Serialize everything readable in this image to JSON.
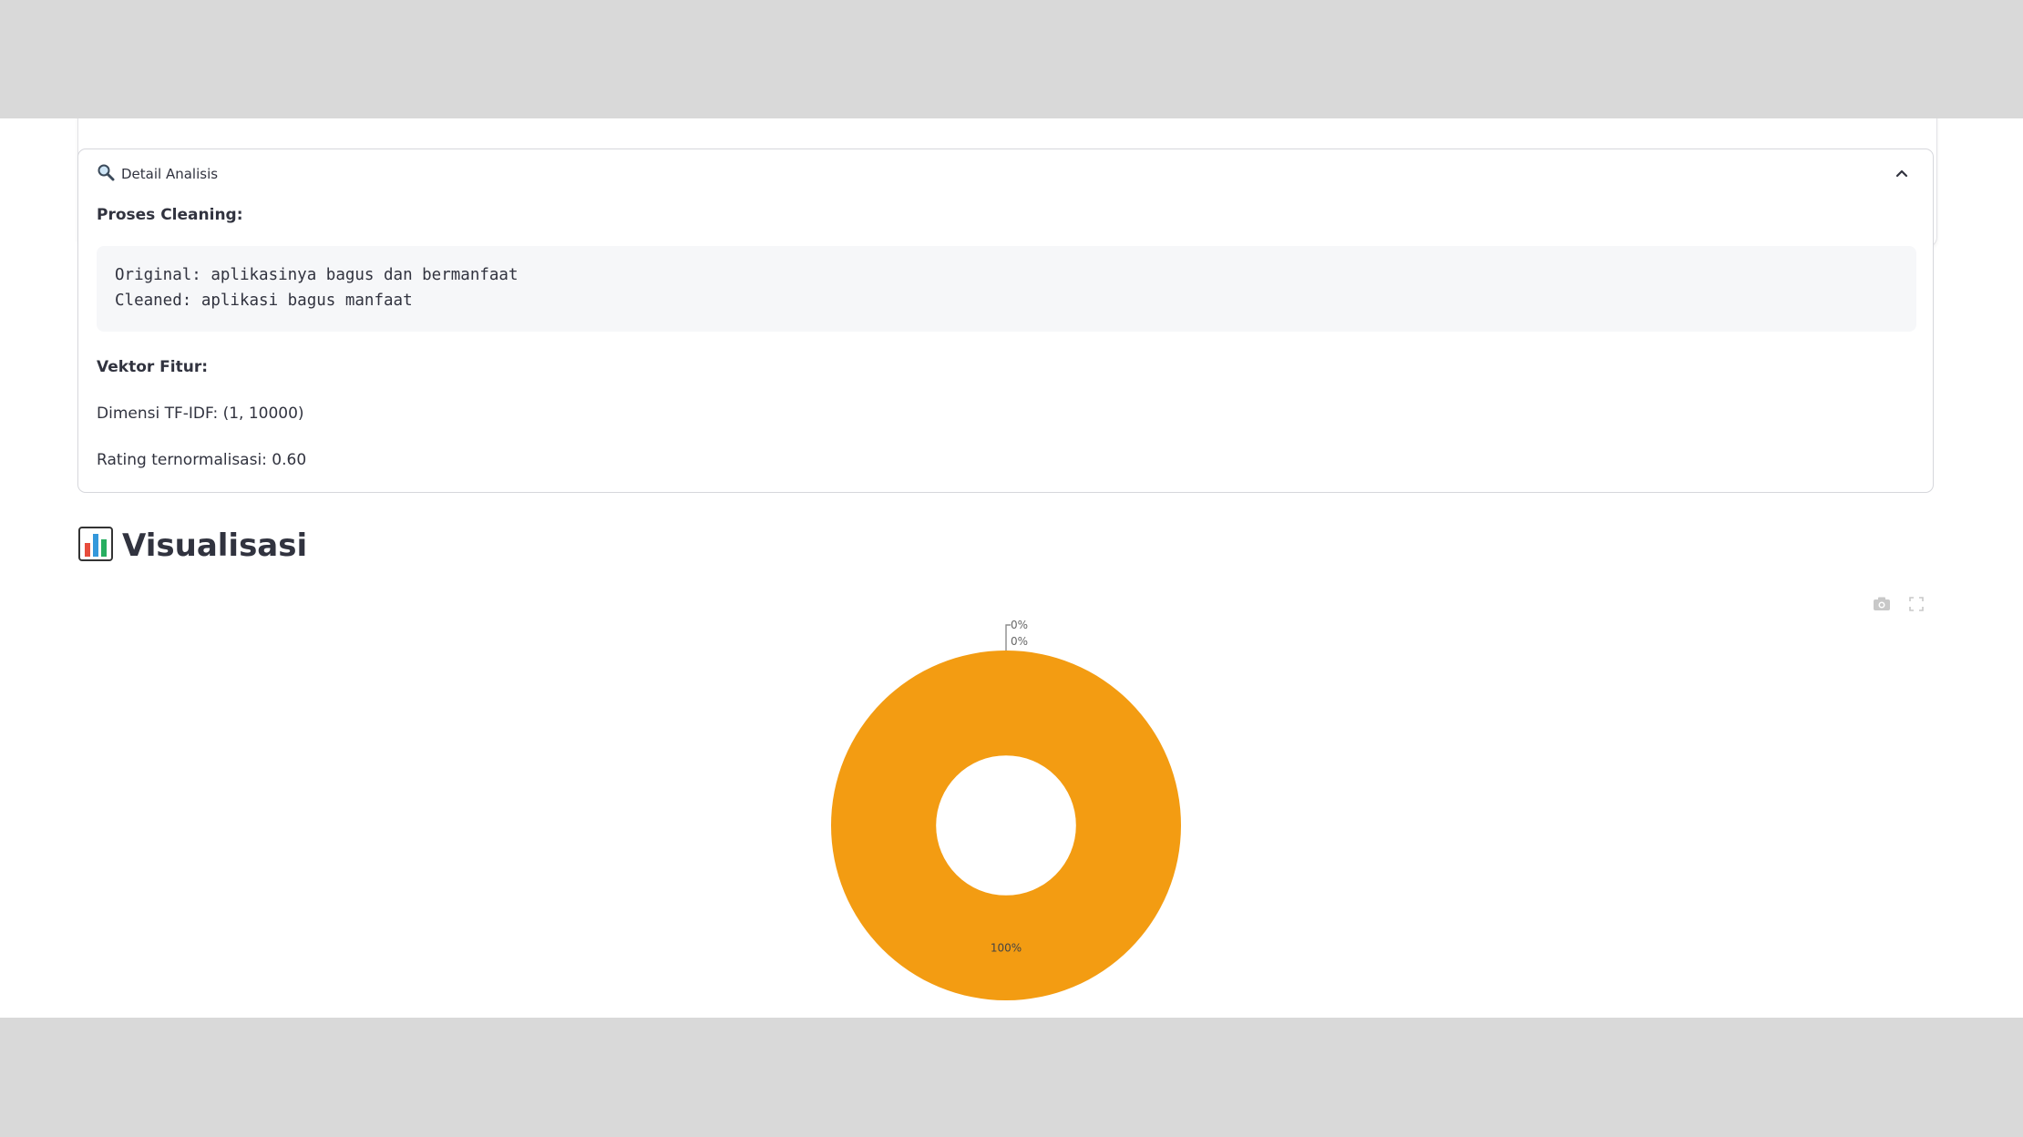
{
  "expander": {
    "title": "Detail Analisis",
    "icon": "magnifier-icon",
    "expanded": true,
    "cleaning_heading": "Proses Cleaning:",
    "code_lines": [
      "Original: aplikasinya bagus dan bermanfaat",
      "Cleaned: aplikasi bagus manfaat"
    ],
    "vector_heading": "Vektor Fitur:",
    "tfidf_text": "Dimensi TF-IDF: (1, 10000)",
    "rating_text": "Rating ternormalisasi: 0.60"
  },
  "visualization": {
    "title": "Visualisasi",
    "icon": "bar-chart-icon"
  },
  "toolbar": {
    "icons": [
      "camera-icon",
      "fullscreen-icon"
    ]
  },
  "colors": {
    "accent": "#f39c12",
    "text": "#31333f",
    "border": "#d6d7dc"
  },
  "chart_data": {
    "type": "pie",
    "hole": 0.4,
    "slices": [
      {
        "label": "",
        "value": 0,
        "text": "0%",
        "color": "#3498db"
      },
      {
        "label": "",
        "value": 0,
        "text": "0%",
        "color": "#e74c3c"
      },
      {
        "label": "",
        "value": 100,
        "text": "100%",
        "color": "#f39c12"
      }
    ]
  }
}
